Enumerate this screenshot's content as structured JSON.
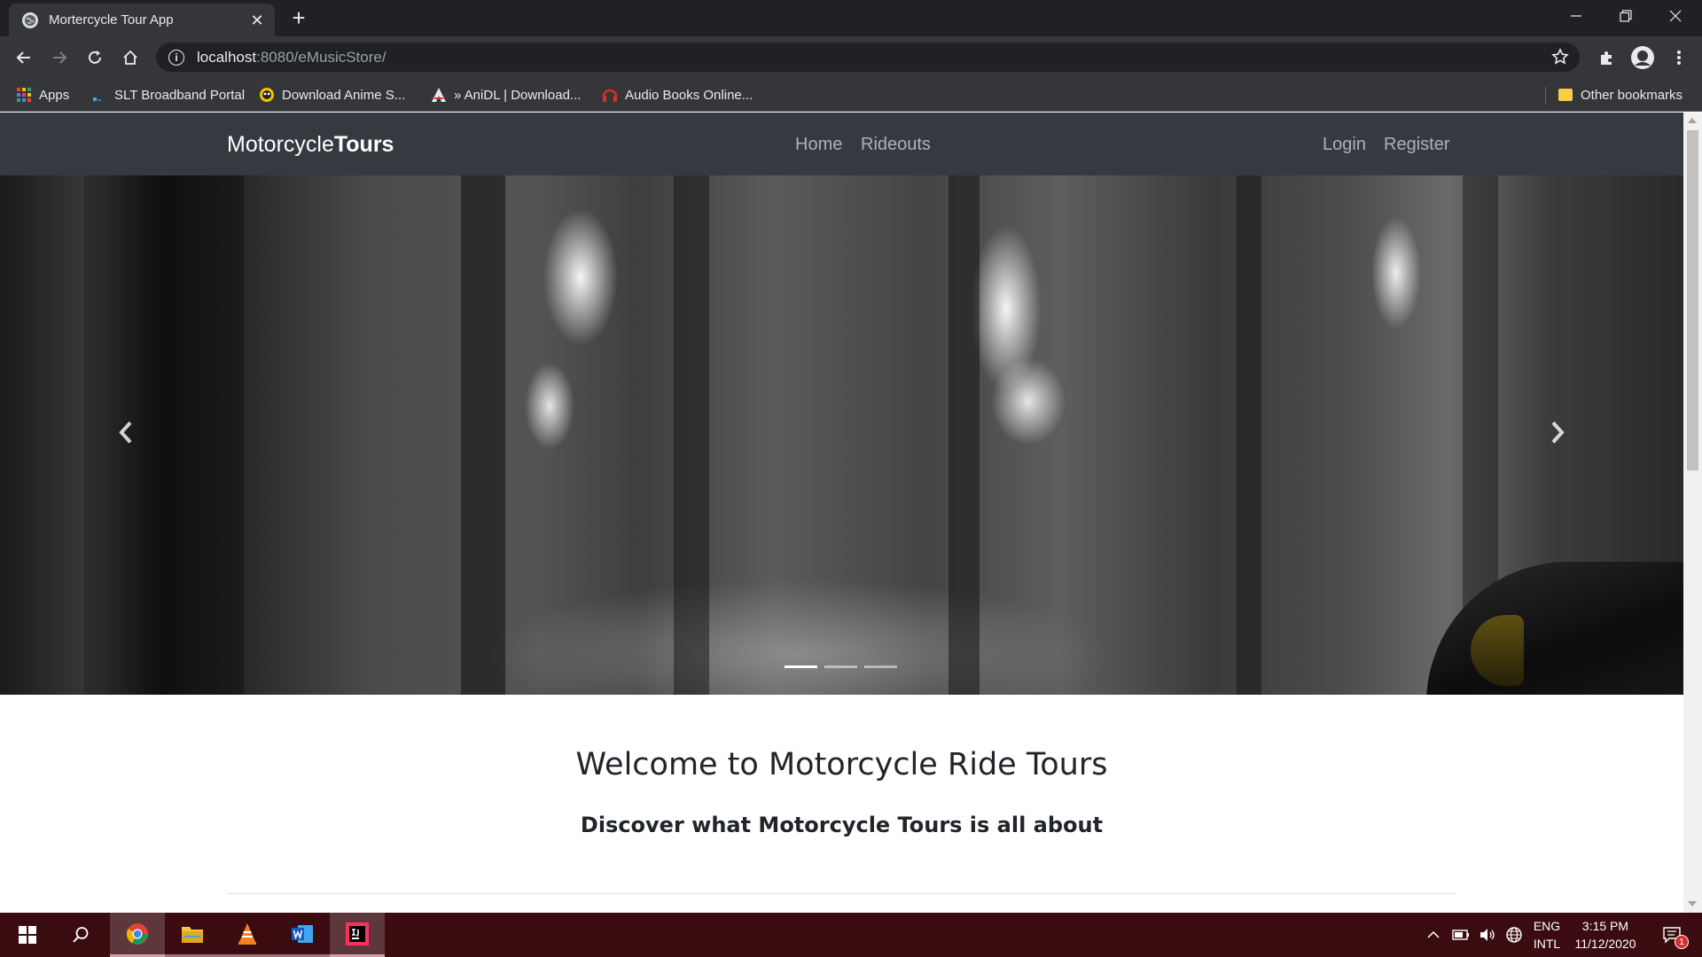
{
  "browser": {
    "tab_title": "Mortercycle Tour App",
    "tab_close": "✕",
    "new_tab": "+",
    "url_host": "localhost",
    "url_rest": ":8080/eMusicStore/"
  },
  "bookmarks": {
    "items": [
      {
        "label": "Apps",
        "icon": "apps-grid-icon"
      },
      {
        "label": "SLT Broadband Portal",
        "icon": "slt-icon"
      },
      {
        "label": "Download Anime S...",
        "icon": "anime-icon"
      },
      {
        "label": "» AniDL | Download...",
        "icon": "anidl-icon"
      },
      {
        "label": "Audio Books Online...",
        "icon": "audiobooks-icon"
      }
    ],
    "other": "Other bookmarks"
  },
  "site": {
    "brand_light": "Motorcycle",
    "brand_bold": "Tours",
    "nav": [
      "Home",
      "Rideouts"
    ],
    "auth": [
      "Login",
      "Register"
    ],
    "carousel": {
      "slides": 3,
      "active_index": 0
    },
    "welcome": "Welcome to Motorcycle Ride Tours",
    "discover": "Discover what Motorcycle Tours is all about"
  },
  "taskbar": {
    "apps": [
      "windows-start-icon",
      "search-icon",
      "chrome-icon",
      "file-explorer-icon",
      "vlc-icon",
      "word-icon",
      "intellij-icon"
    ],
    "lang_top": "ENG",
    "lang_bottom": "INTL",
    "time": "3:15 PM",
    "date": "11/12/2020",
    "notification_count": "1"
  },
  "colors": {
    "site_nav": "#343a40",
    "taskbar": "#3a0c10",
    "chrome_dark": "#202124",
    "chrome_toolbar": "#35363a"
  }
}
